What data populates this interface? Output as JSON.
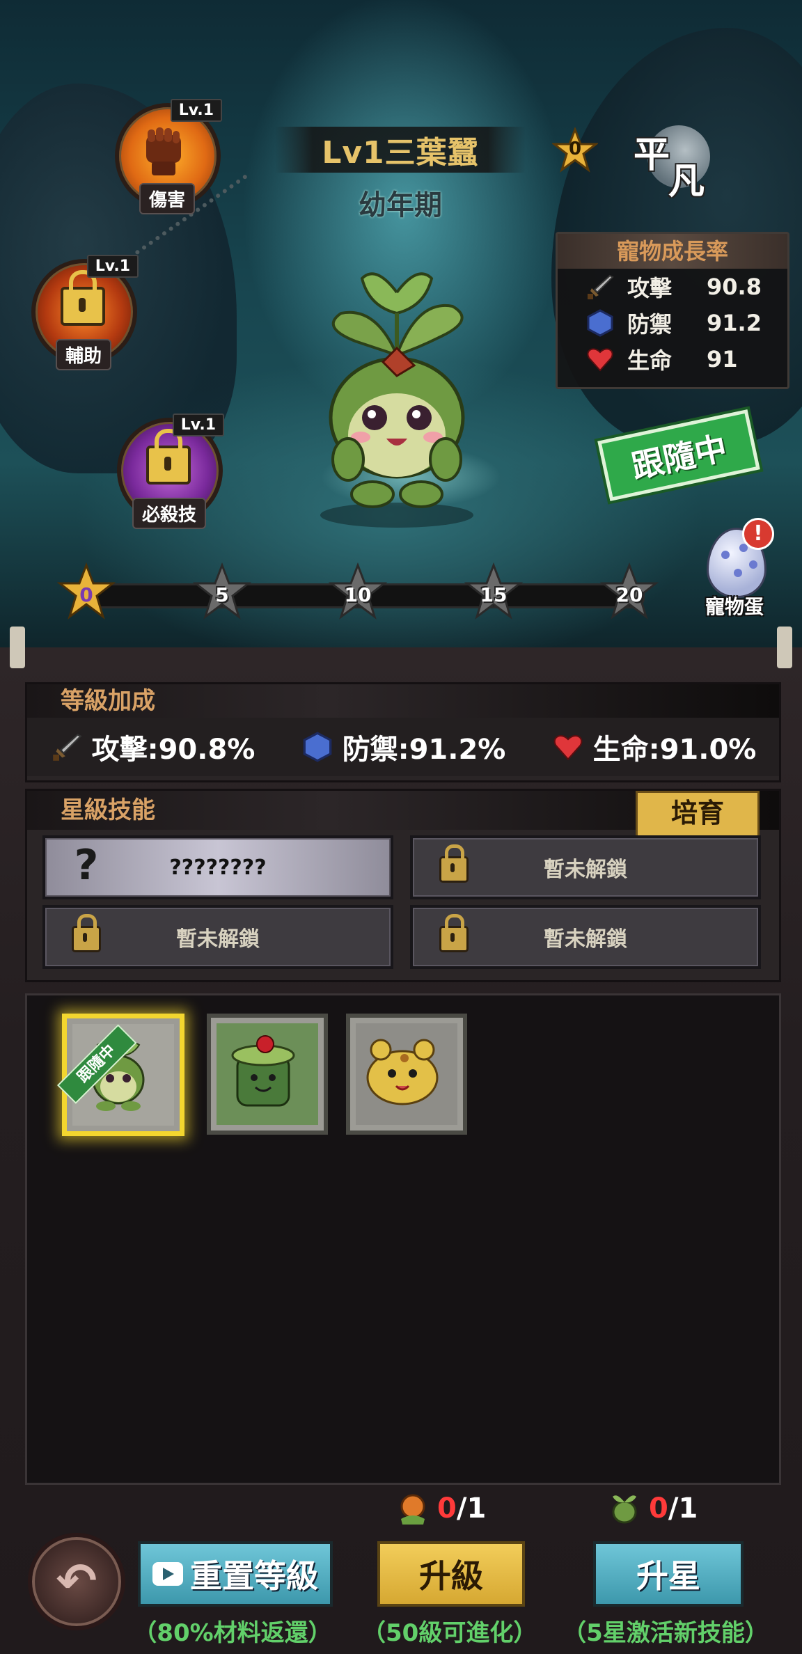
{
  "pet": {
    "title": "Lv1三葉蠶",
    "stage": "幼年期",
    "star_count": "0",
    "rarity_1": "平",
    "rarity_2": "凡"
  },
  "skills_top": [
    {
      "level": "Lv.1",
      "label": "傷害"
    },
    {
      "level": "Lv.1",
      "label": "輔助"
    },
    {
      "level": "Lv.1",
      "label": "必殺技"
    }
  ],
  "growth": {
    "title": "寵物成長率",
    "rows": [
      {
        "label": "攻擊",
        "value": "90.8"
      },
      {
        "label": "防禦",
        "value": "91.2"
      },
      {
        "label": "生命",
        "value": "91"
      }
    ]
  },
  "follow_stamp": "跟隨中",
  "egg_label": "寵物蛋",
  "milestones": [
    "0",
    "5",
    "10",
    "15",
    "20"
  ],
  "level_bonus": {
    "title": "等級加成",
    "attack": "攻擊:90.8%",
    "defense": "防禦:91.2%",
    "hp": "生命:91.0%"
  },
  "star_skills": {
    "title": "星級技能",
    "foster_label": "培育",
    "slots": [
      "????????",
      "暫未解鎖",
      "暫未解鎖",
      "暫未解鎖"
    ]
  },
  "pet_list": {
    "follow_tag": "跟隨中"
  },
  "actions": {
    "reset_label": "重置等級",
    "reset_note": "（80%材料返還）",
    "upgrade_label": "升級",
    "upgrade_note": "（50級可進化）",
    "upgrade_cost_have": "0",
    "upgrade_cost_need": "/1",
    "star_label": "升星",
    "star_note": "（5星激活新技能）",
    "star_cost_have": "0",
    "star_cost_need": "/1"
  },
  "colors": {
    "title_gold": "#e6c36a",
    "panel_header": "#d9a266",
    "note_green": "#62d06a",
    "cost_red": "#ff3a3a",
    "foster_gold": "#e0b64a",
    "teal_button": "#4fb0c4"
  },
  "icons": {
    "damage_skill": "fist-icon",
    "aid_skill": "lock-icon",
    "ultimate_skill": "lock-icon",
    "attack": "sword-icon",
    "defense": "hexagon-shield-icon",
    "hp": "heart-icon",
    "unknown_skill": "question-mark-icon",
    "locked_skill": "lock-icon",
    "back": "back-arrow-icon",
    "video": "video-play-icon"
  }
}
